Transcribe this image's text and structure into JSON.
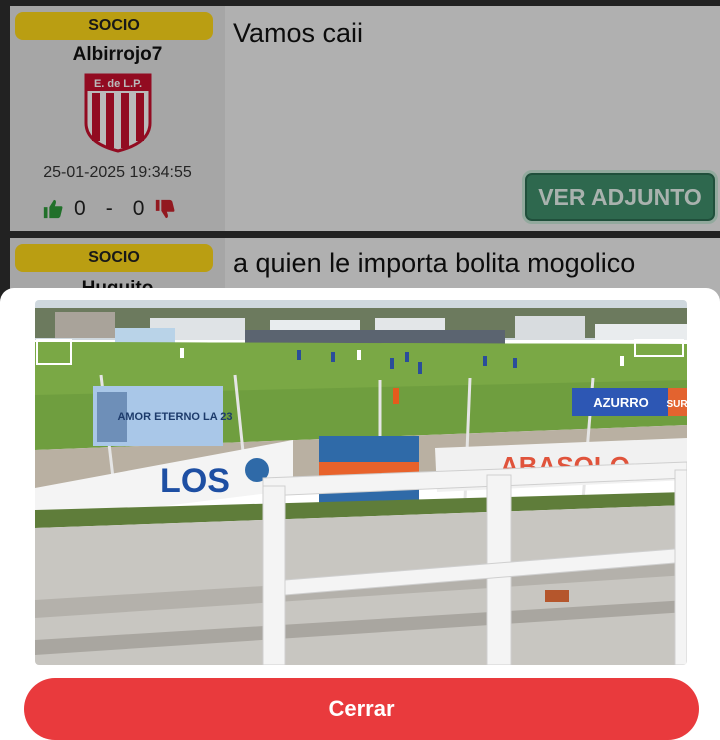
{
  "posts": [
    {
      "badge": "SOCIO",
      "username": "Albirrojo7",
      "crest_label": "E. de L.P.",
      "date": "25-01-2025 19:34:55",
      "likes": "0",
      "separator": "-",
      "dislikes": "0",
      "message": "Vamos caii",
      "attachment_label": "VER ADJUNTO"
    },
    {
      "badge": "SOCIO",
      "username": "Huguito",
      "message": "a quien le importa bolita mogolico"
    }
  ],
  "modal": {
    "image_alt": "Foto de la tribuna",
    "banner_texts": {
      "left_banner": "AMOR ETERNO LA 23",
      "los_flag": "LOS",
      "right_flag": "AZURRO",
      "sur_flag": "SUR",
      "red_banner": "ABASOLO"
    },
    "close_label": "Cerrar"
  },
  "colors": {
    "badge_yellow": "#ffd91a",
    "attach_green": "#3f8f6c",
    "close_red": "#e93a3d",
    "like_green": "#2e9a3a",
    "dislike_red": "#c8232c"
  }
}
